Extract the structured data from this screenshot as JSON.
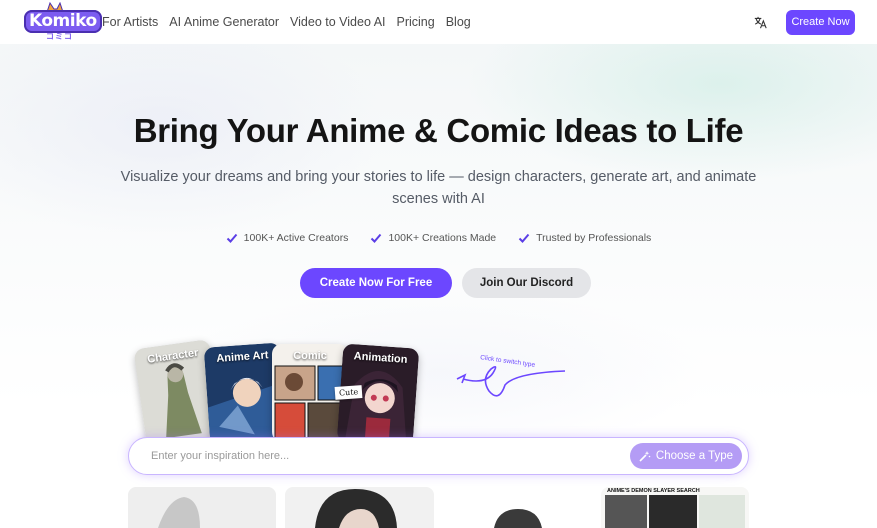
{
  "brand": {
    "name": "Komiko",
    "subtitle": "コミコ"
  },
  "nav": {
    "links": [
      "For Artists",
      "AI Anime Generator",
      "Video to Video AI",
      "Pricing",
      "Blog"
    ],
    "language_icon": "translate-icon",
    "cta_label": "Create Now"
  },
  "hero": {
    "title": "Bring Your Anime & Comic Ideas to Life",
    "subtitle": "Visualize your dreams and bring your stories to life — design characters, generate art, and animate scenes with AI",
    "badges": [
      "100K+ Active Creators",
      "100K+ Creations Made",
      "Trusted by Professionals"
    ],
    "primary_cta": "Create Now For Free",
    "secondary_cta": "Join Our Discord"
  },
  "type_cards": [
    {
      "label": "Character"
    },
    {
      "label": "Anime Art"
    },
    {
      "label": "Comic"
    },
    {
      "label": "Animation",
      "tag": "Cute"
    }
  ],
  "switch_hint": "Click to switch type",
  "search": {
    "placeholder": "Enter your inspiration here...",
    "type_button": "Choose a Type",
    "type_button_icon": "magic-wand-icon"
  },
  "gallery": {
    "caption_4": "ANIME'S DEMON SLAYER SEARCH"
  },
  "colors": {
    "accent": "#6c47ff",
    "accent_soft": "#b49cf5",
    "secondary_button": "#e4e5e8",
    "check": "#5b3ee6"
  }
}
